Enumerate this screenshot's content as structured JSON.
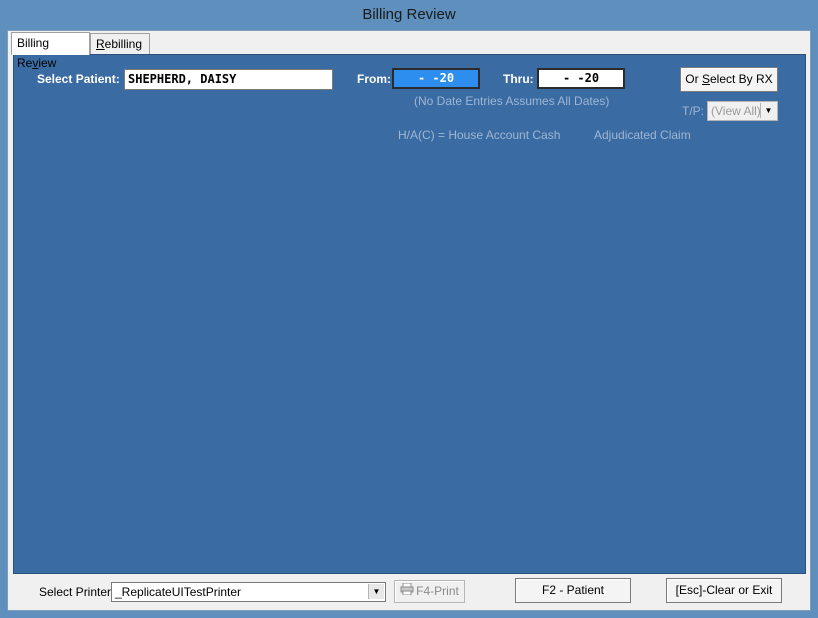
{
  "window": {
    "title": "Billing Review"
  },
  "tabs": [
    {
      "label_pre": "Billing Re",
      "label_u": "v",
      "label_post": "iew"
    },
    {
      "label_pre": "",
      "label_u": "R",
      "label_post": "ebilling"
    }
  ],
  "patient": {
    "label": "Select Patient:",
    "value": "SHEPHERD, DAISY"
  },
  "dates": {
    "from_label": "From:",
    "from_value": "-  -20",
    "thru_label": "Thru:",
    "thru_value": "-  -20",
    "hint": "(No Date Entries Assumes All Dates)"
  },
  "select_rx_button": {
    "label_pre": "Or ",
    "label_u": "S",
    "label_post": "elect By RX"
  },
  "tp": {
    "label": "T/P:",
    "value": "(View All)"
  },
  "legend": {
    "house_account": "H/A(C) = House Account Cash",
    "adjudicated": "Adjudicated Claim"
  },
  "footer": {
    "printer_label": "Select Printer:",
    "printer_value": "_ReplicateUITestPrinter",
    "print_button": "F4-Print",
    "patient_button": "F2 - Patient",
    "exit_button": "[Esc]-Clear or Exit"
  },
  "colors": {
    "panel": "#3a6ba3",
    "date_highlight": "#2d8ef0",
    "titlebar": "#5f8fbd"
  },
  "icons": {
    "printer": "printer-icon",
    "dropdown": "chevron-down-icon"
  }
}
